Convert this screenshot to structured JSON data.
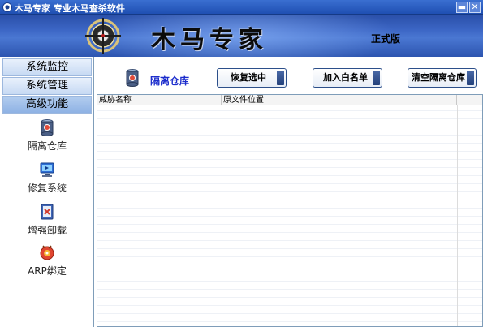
{
  "window": {
    "title": "木马专家  专业木马查杀软件",
    "minimize_label": "▬",
    "close_label": "✕"
  },
  "banner": {
    "brand": "木马专家",
    "edition": "正式版"
  },
  "sidebar": {
    "headers": [
      {
        "label": "系统监控"
      },
      {
        "label": "系统管理"
      },
      {
        "label": "高级功能"
      }
    ],
    "items": [
      {
        "label": "隔离仓库",
        "icon": "quarantine-icon"
      },
      {
        "label": "修复系统",
        "icon": "repair-system-icon"
      },
      {
        "label": "增强卸载",
        "icon": "uninstall-icon"
      },
      {
        "label": "ARP绑定",
        "icon": "arp-bind-icon"
      }
    ]
  },
  "main": {
    "module_title": "隔离仓库",
    "buttons": {
      "restore": "恢复选中",
      "whitelist": "加入白名单",
      "clear": "清空隔离仓库"
    },
    "table": {
      "columns": [
        "威胁名称",
        "原文件位置",
        ""
      ]
    }
  },
  "colors": {
    "title_bar": "#2a5cc2",
    "banner": "#3b65c4",
    "module_title": "#1b2ccc",
    "button_border": "#2c4f8a"
  }
}
